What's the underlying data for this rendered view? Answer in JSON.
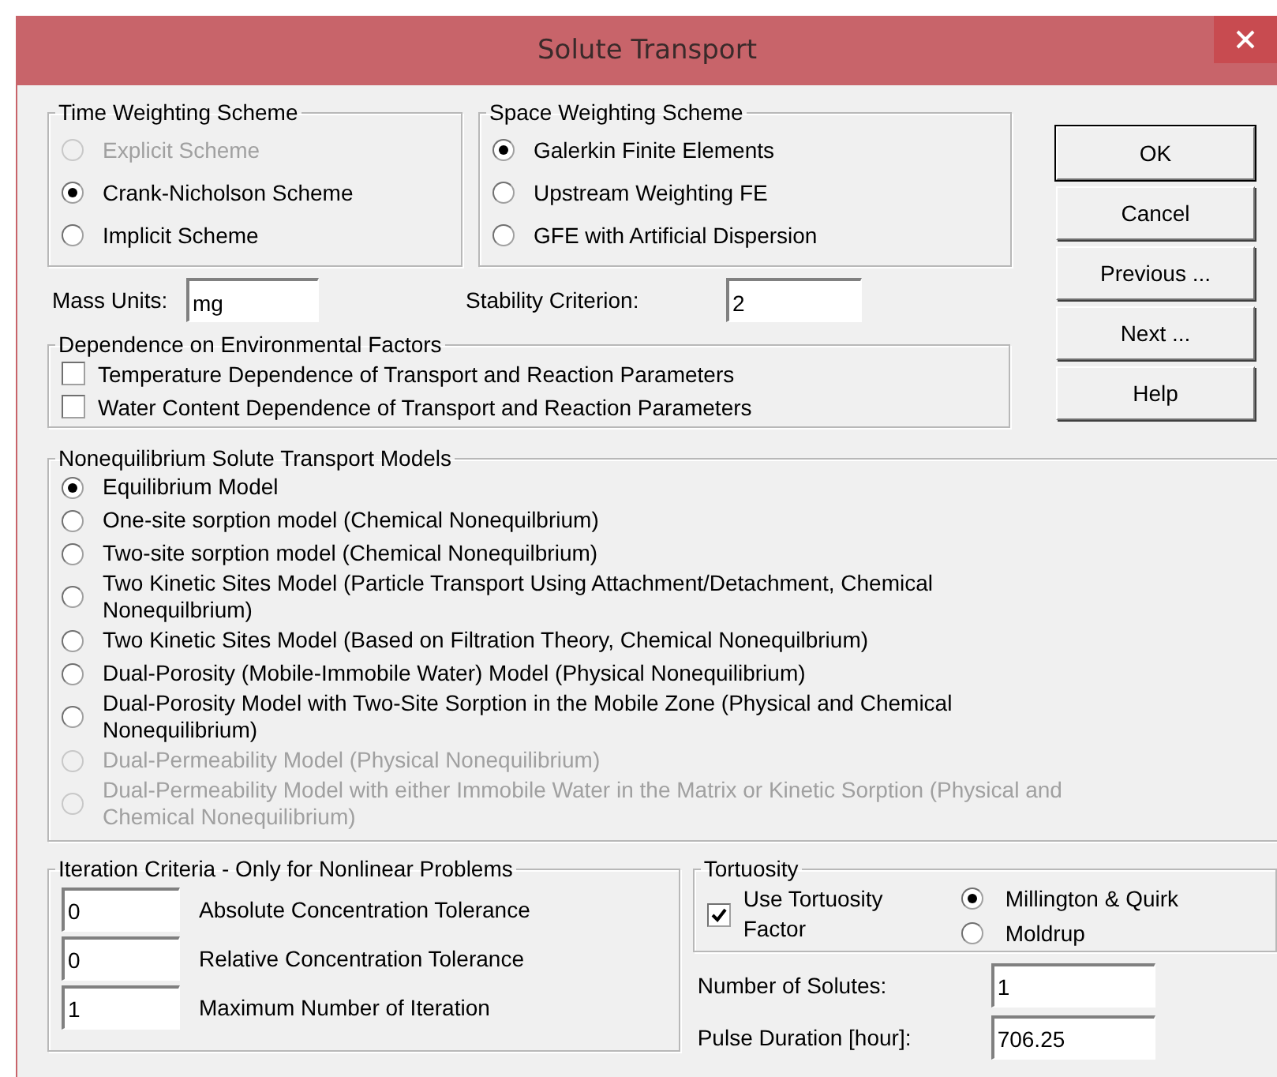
{
  "window": {
    "title": "Solute Transport"
  },
  "time_weighting": {
    "title": "Time Weighting Scheme",
    "options": [
      {
        "label": "Explicit Scheme",
        "selected": false,
        "disabled": true
      },
      {
        "label": "Crank-Nicholson Scheme",
        "selected": true,
        "disabled": false
      },
      {
        "label": "Implicit Scheme",
        "selected": false,
        "disabled": false
      }
    ]
  },
  "space_weighting": {
    "title": "Space Weighting Scheme",
    "options": [
      {
        "label": "Galerkin Finite Elements",
        "selected": true,
        "disabled": false
      },
      {
        "label": "Upstream Weighting FE",
        "selected": false,
        "disabled": false
      },
      {
        "label": "GFE with Artificial Dispersion",
        "selected": false,
        "disabled": false
      }
    ]
  },
  "buttons": [
    "OK",
    "Cancel",
    "Previous ...",
    "Next ...",
    "Help"
  ],
  "mass_units": {
    "label": "Mass Units:",
    "value": "mg"
  },
  "stability_criterion": {
    "label": "Stability Criterion:",
    "value": "2"
  },
  "environmental_factors": {
    "title": "Dependence on Environmental Factors",
    "options": [
      {
        "label": "Temperature Dependence of Transport and Reaction Parameters",
        "checked": false
      },
      {
        "label": "Water Content Dependence of Transport and Reaction Parameters",
        "checked": false
      }
    ]
  },
  "nonequilibrium_models": {
    "title": "Nonequilibrium Solute Transport Models",
    "options": [
      {
        "label": "Equilibrium Model",
        "selected": true,
        "disabled": false
      },
      {
        "label": "One-site sorption model (Chemical Nonequilbrium)",
        "selected": false,
        "disabled": false
      },
      {
        "label": "Two-site sorption model (Chemical Nonequilbrium)",
        "selected": false,
        "disabled": false
      },
      {
        "label": "Two Kinetic Sites Model (Particle Transport Using Attachment/Detachment, Chemical Nonequilbrium)",
        "selected": false,
        "disabled": false
      },
      {
        "label": "Two Kinetic Sites Model (Based on Filtration Theory, Chemical Nonequilbrium)",
        "selected": false,
        "disabled": false
      },
      {
        "label": "Dual-Porosity (Mobile-Immobile Water) Model (Physical Nonequilibrium)",
        "selected": false,
        "disabled": false
      },
      {
        "label": "Dual-Porosity Model with Two-Site Sorption in the Mobile Zone (Physical and Chemical Nonequilibrium)",
        "selected": false,
        "disabled": false
      },
      {
        "label": "Dual-Permeability Model (Physical Nonequilibrium)",
        "selected": false,
        "disabled": true
      },
      {
        "label": "Dual-Permeability Model with either Immobile Water in the Matrix or Kinetic Sorption (Physical and Chemical Nonequilibrium)",
        "selected": false,
        "disabled": true
      }
    ]
  },
  "iteration_criteria": {
    "title": "Iteration Criteria - Only for Nonlinear Problems",
    "fields": [
      {
        "label": "Absolute Concentration Tolerance",
        "value": "0"
      },
      {
        "label": "Relative Concentration Tolerance",
        "value": "0"
      },
      {
        "label": "Maximum Number of Iteration",
        "value": "1"
      }
    ]
  },
  "tortuosity": {
    "title": "Tortuosity",
    "use_factor": {
      "label": "Use Tortuosity Factor",
      "checked": true
    },
    "options": [
      {
        "label": "Millington & Quirk",
        "selected": true,
        "disabled": false
      },
      {
        "label": "Moldrup",
        "selected": false,
        "disabled": false
      }
    ]
  },
  "number_of_solutes": {
    "label": "Number of Solutes:",
    "value": "1"
  },
  "pulse_duration": {
    "label": "Pulse Duration [hour]:",
    "value": "706.25"
  }
}
